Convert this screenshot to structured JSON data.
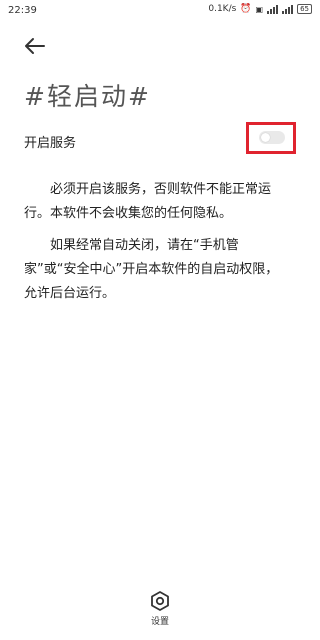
{
  "status_bar": {
    "time": "22:39",
    "speed": "0.1K/s",
    "battery": "65"
  },
  "header": {
    "back_icon": "back-arrow-icon"
  },
  "page": {
    "title": "#轻启动#"
  },
  "service": {
    "label": "开启服务",
    "enabled": false,
    "highlight_color": "#e0232f"
  },
  "paragraphs": [
    "必须开启该服务，否则软件不能正常运行。本软件不会收集您的任何隐私。",
    "如果经常自动关闭，请在“手机管家”或“安全中心”开启本软件的自启动权限，允许后台运行。"
  ],
  "bottom_nav": {
    "settings_label": "设置",
    "settings_icon": "settings-hex-icon"
  }
}
